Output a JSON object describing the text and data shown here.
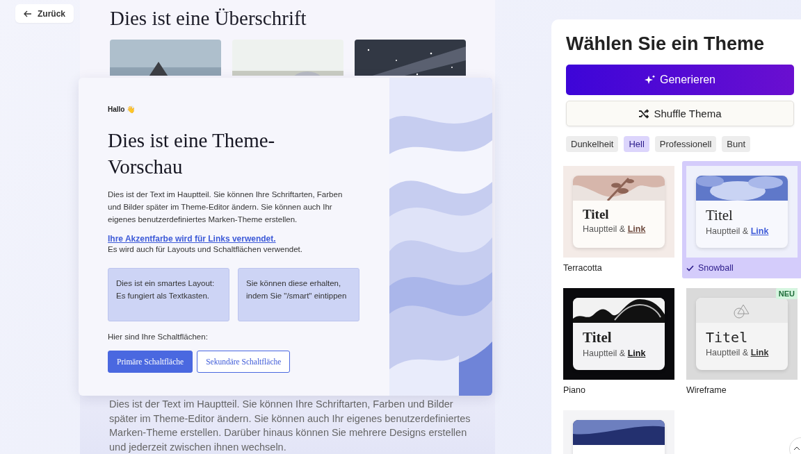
{
  "back_button": {
    "label": "Zurück"
  },
  "preview": {
    "page": {
      "heading": "Dies ist eine Überschrift",
      "body": "Dies ist der Text im Hauptteil. Sie können Ihre Schriftarten, Farben und Bilder später im Theme-Editor ändern. Sie können auch Ihr eigenes benutzerdefiniertes Marken-Theme erstellen. Darüber hinaus können Sie mehrere Designs erstellen und jederzeit zwischen ihnen wechseln."
    },
    "card": {
      "greeting": "Hallo 👋",
      "title": "Dies ist eine Theme-Vorschau",
      "body": "Dies ist der Text im Hauptteil. Sie können Ihre Schriftarten, Farben und Bilder später im Theme-Editor ändern. Sie können auch Ihr eigenes benutzerdefiniertes Marken-Theme erstellen.",
      "link": "Ihre Akzentfarbe wird für Links verwendet.",
      "note": "Es wird auch für Layouts und Schaltflächen verwendet.",
      "smart_boxes": [
        "Dies ist ein smartes Layout: Es fungiert als Textkasten.",
        "Sie können diese erhalten, indem Sie \"/smart\" eintippen"
      ],
      "buttons_label": "Hier sind Ihre Schaltflächen:",
      "buttons": [
        {
          "label": "Primäre Schaltfläche",
          "kind": "primary"
        },
        {
          "label": "Sekundäre Schaltfläche",
          "kind": "secondary"
        }
      ]
    }
  },
  "panel": {
    "title": "Wählen Sie ein Theme",
    "generate_button": "Generieren",
    "shuffle_button": "Shuffle Thema",
    "filters": [
      {
        "label": "Dunkelheit",
        "selected": false
      },
      {
        "label": "Hell",
        "selected": true
      },
      {
        "label": "Professionell",
        "selected": false
      },
      {
        "label": "Bunt",
        "selected": false
      }
    ],
    "themes": [
      {
        "kind": "terracotta",
        "name": "Terracotta",
        "selected": false,
        "title": "Titel",
        "body": "Hauptteil &",
        "link": "Link"
      },
      {
        "kind": "snowball",
        "name": "Snowball",
        "selected": true,
        "title": "Titel",
        "body": "Hauptteil &",
        "link": "Link"
      },
      {
        "kind": "piano",
        "name": "Piano",
        "selected": false,
        "title": "Titel",
        "body": "Hauptteil &",
        "link": "Link"
      },
      {
        "kind": "wireframe",
        "name": "Wireframe",
        "selected": false,
        "badge": "NEU",
        "title": "Titel",
        "body": "Hauptteil &",
        "link": "Link"
      },
      {
        "kind": "navy",
        "selected": false
      }
    ]
  }
}
